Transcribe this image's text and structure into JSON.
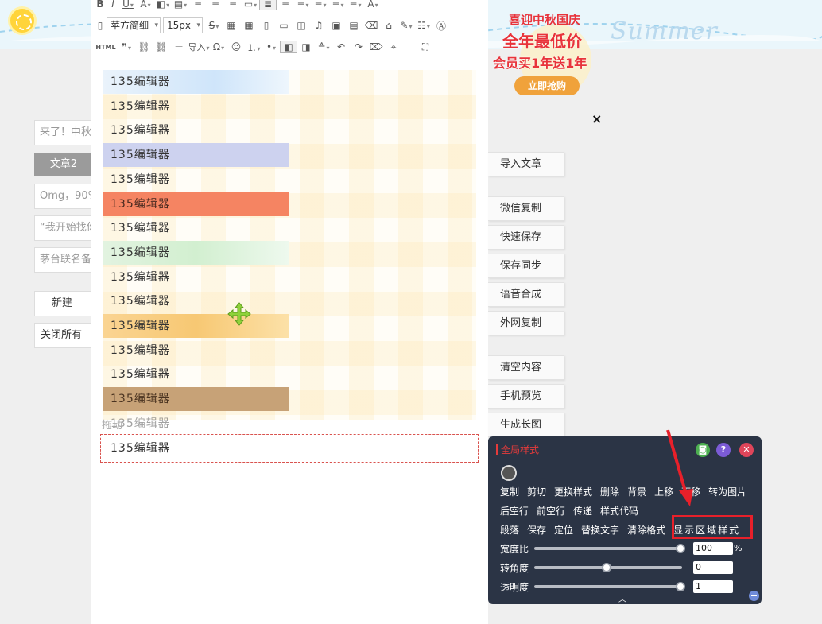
{
  "banner": {
    "decor_text": "Summer",
    "promo_line1": "喜迎中秋国庆",
    "promo_line2": "全年最低价",
    "promo_line3": "会员买1年送1年",
    "promo_button": "立即抢购"
  },
  "close_label": "×",
  "left": {
    "inputs": [
      "来了！中秋",
      "Omg，90%",
      "“我开始找你",
      "茅台联名备"
    ],
    "active_tab": "文章2",
    "new_btn": "新建",
    "close_all_btn": "关闭所有"
  },
  "toolbar": {
    "font_family": "苹方简细",
    "font_size": "15px",
    "html_label": "HTML",
    "import_label": "导入"
  },
  "editor": {
    "rows": [
      "135编辑器",
      "135编辑器",
      "135编辑器",
      "135编辑器",
      "135编辑器",
      "135编辑器",
      "135编辑器",
      "135编辑器",
      "135编辑器",
      "135编辑器",
      "135编辑器",
      "135编辑器",
      "135编辑器",
      "135编辑器",
      "135编辑器"
    ],
    "drag_ghost": "拖动",
    "selected_row": "135编辑器"
  },
  "side_buttons": [
    "导入文章",
    "微信复制",
    "快速保存",
    "保存同步",
    "语音合成",
    "外网复制",
    "清空内容",
    "手机预览",
    "生成长图"
  ],
  "panel": {
    "title": "全局样式",
    "row1": [
      "复制",
      "剪切",
      "更换样式",
      "删除",
      "背景",
      "上移",
      "下移",
      "转为图片"
    ],
    "row2": [
      "后空行",
      "前空行",
      "传递",
      "样式代码"
    ],
    "row3": [
      "段落",
      "保存",
      "定位",
      "替换文字",
      "清除格式"
    ],
    "highlighted": "显示区域样式",
    "sliders": [
      {
        "label": "宽度比",
        "value": "100",
        "level": 1.0
      },
      {
        "label": "转角度",
        "value": "0",
        "level": 0.5
      },
      {
        "label": "透明度",
        "value": "1",
        "level": 1.0
      }
    ],
    "percent": "%",
    "icons": [
      "save-icon",
      "help-icon",
      "close-icon"
    ]
  }
}
